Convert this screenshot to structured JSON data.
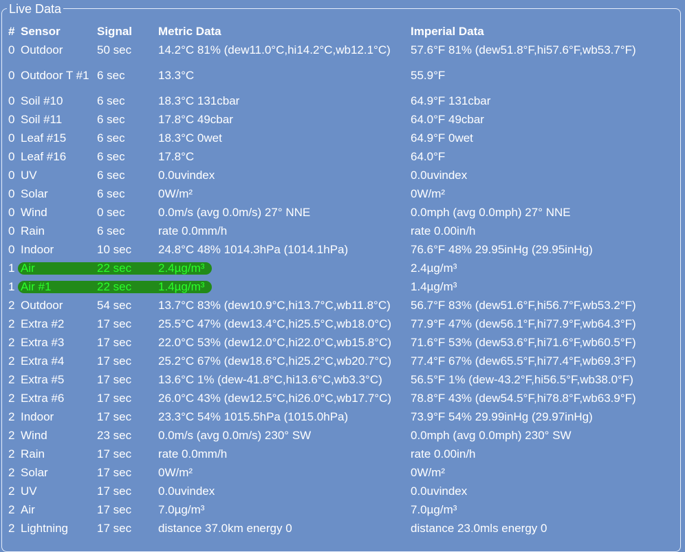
{
  "panel": {
    "legend": "Live Data"
  },
  "headers": {
    "num": "#",
    "sensor": "Sensor",
    "signal": "Signal",
    "metric": "Metric Data",
    "imperial": "Imperial Data"
  },
  "rows": [
    {
      "num": "0",
      "sensor": "Outdoor",
      "signal": "50 sec",
      "metric": "14.2°C 81% (dew11.0°C,hi14.2°C,wb12.1°C)",
      "imperial": "57.6°F 81% (dew51.8°F,hi57.6°F,wb53.7°F)"
    },
    {
      "num": "0",
      "sensor": "Outdoor T #1",
      "signal": "6 sec",
      "metric": "13.3°C",
      "imperial": "55.9°F"
    },
    {
      "num": "0",
      "sensor": "Soil #10",
      "signal": "6 sec",
      "metric": "18.3°C 131cbar",
      "imperial": "64.9°F 131cbar"
    },
    {
      "num": "0",
      "sensor": "Soil #11",
      "signal": "6 sec",
      "metric": "17.8°C 49cbar",
      "imperial": "64.0°F 49cbar"
    },
    {
      "num": "0",
      "sensor": "Leaf #15",
      "signal": "6 sec",
      "metric": "18.3°C 0wet",
      "imperial": "64.9°F 0wet"
    },
    {
      "num": "0",
      "sensor": "Leaf #16",
      "signal": "6 sec",
      "metric": "17.8°C",
      "imperial": "64.0°F"
    },
    {
      "num": "0",
      "sensor": "UV",
      "signal": "6 sec",
      "metric": "0.0uvindex",
      "imperial": "0.0uvindex"
    },
    {
      "num": "0",
      "sensor": "Solar",
      "signal": "6 sec",
      "metric": "0W/m²",
      "imperial": "0W/m²"
    },
    {
      "num": "0",
      "sensor": "Wind",
      "signal": "0 sec",
      "metric": "0.0m/s (avg 0.0m/s) 27° NNE",
      "imperial": "0.0mph (avg 0.0mph) 27° NNE"
    },
    {
      "num": "0",
      "sensor": "Rain",
      "signal": "6 sec",
      "metric": "rate 0.0mm/h",
      "imperial": "rate 0.00in/h"
    },
    {
      "num": "0",
      "sensor": "Indoor",
      "signal": "10 sec",
      "metric": "24.8°C 48% 1014.3hPa (1014.1hPa)",
      "imperial": "76.6°F 48% 29.95inHg (29.95inHg)"
    },
    {
      "num": "1",
      "sensor": "Air",
      "signal": "22 sec",
      "metric": "2.4µg/m³",
      "imperial": "2.4µg/m³"
    },
    {
      "num": "1",
      "sensor": "Air #1",
      "signal": "22 sec",
      "metric": "1.4µg/m³",
      "imperial": "1.4µg/m³"
    },
    {
      "num": "2",
      "sensor": "Outdoor",
      "signal": "54 sec",
      "metric": "13.7°C 83% (dew10.9°C,hi13.7°C,wb11.8°C)",
      "imperial": "56.7°F 83% (dew51.6°F,hi56.7°F,wb53.2°F)"
    },
    {
      "num": "2",
      "sensor": "Extra #2",
      "signal": "17 sec",
      "metric": "25.5°C 47% (dew13.4°C,hi25.5°C,wb18.0°C)",
      "imperial": "77.9°F 47% (dew56.1°F,hi77.9°F,wb64.3°F)"
    },
    {
      "num": "2",
      "sensor": "Extra #3",
      "signal": "17 sec",
      "metric": "22.0°C 53% (dew12.0°C,hi22.0°C,wb15.8°C)",
      "imperial": "71.6°F 53% (dew53.6°F,hi71.6°F,wb60.5°F)"
    },
    {
      "num": "2",
      "sensor": "Extra #4",
      "signal": "17 sec",
      "metric": "25.2°C 67% (dew18.6°C,hi25.2°C,wb20.7°C)",
      "imperial": "77.4°F 67% (dew65.5°F,hi77.4°F,wb69.3°F)"
    },
    {
      "num": "2",
      "sensor": "Extra #5",
      "signal": "17 sec",
      "metric": "13.6°C 1% (dew-41.8°C,hi13.6°C,wb3.3°C)",
      "imperial": "56.5°F 1% (dew-43.2°F,hi56.5°F,wb38.0°F)"
    },
    {
      "num": "2",
      "sensor": "Extra #6",
      "signal": "17 sec",
      "metric": "26.0°C 43% (dew12.5°C,hi26.0°C,wb17.7°C)",
      "imperial": "78.8°F 43% (dew54.5°F,hi78.8°F,wb63.9°F)"
    },
    {
      "num": "2",
      "sensor": "Indoor",
      "signal": "17 sec",
      "metric": "23.3°C 54% 1015.5hPa (1015.0hPa)",
      "imperial": "73.9°F 54% 29.99inHg (29.97inHg)"
    },
    {
      "num": "2",
      "sensor": "Wind",
      "signal": "23 sec",
      "metric": "0.0m/s (avg 0.0m/s) 230° SW",
      "imperial": "0.0mph (avg 0.0mph) 230° SW"
    },
    {
      "num": "2",
      "sensor": "Rain",
      "signal": "17 sec",
      "metric": "rate 0.0mm/h",
      "imperial": "rate 0.00in/h"
    },
    {
      "num": "2",
      "sensor": "Solar",
      "signal": "17 sec",
      "metric": "0W/m²",
      "imperial": "0W/m²"
    },
    {
      "num": "2",
      "sensor": "UV",
      "signal": "17 sec",
      "metric": "0.0uvindex",
      "imperial": "0.0uvindex"
    },
    {
      "num": "2",
      "sensor": "Air",
      "signal": "17 sec",
      "metric": "7.0µg/m³",
      "imperial": "7.0µg/m³"
    },
    {
      "num": "2",
      "sensor": "Lightning",
      "signal": "17 sec",
      "metric": "distance 37.0km energy 0",
      "imperial": "distance 23.0mls energy 0"
    }
  ],
  "colors": {
    "background": "#6b8fc7",
    "text": "#ffffff",
    "highlight_text": "#2bff2b",
    "highlight_marker": "#1f8a10"
  }
}
